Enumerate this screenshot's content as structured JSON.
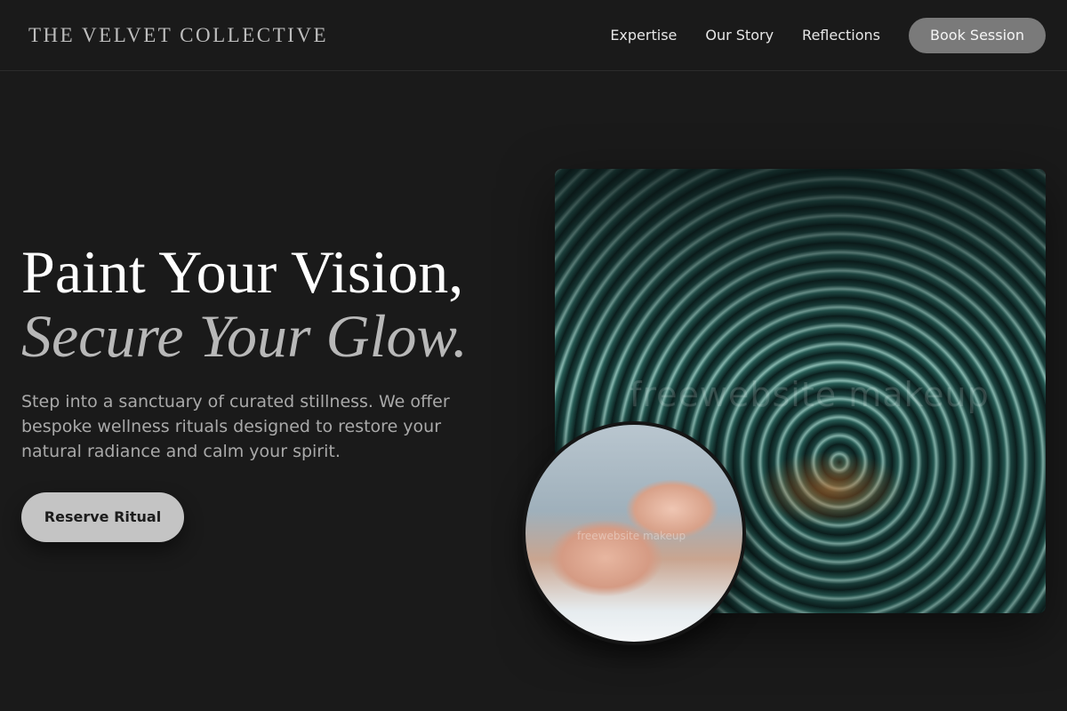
{
  "brand": {
    "name": "THE VELVET COLLECTIVE"
  },
  "nav": {
    "links": [
      "Expertise",
      "Our Story",
      "Reflections"
    ],
    "cta": "Book Session"
  },
  "hero": {
    "title_line1": "Paint Your Vision,",
    "title_line2": "Secure Your Glow.",
    "description": "Step into a sanctuary of curated stillness. We offer bespoke wellness rituals designed to restore your natural radiance and calm your spirit.",
    "cta": "Reserve Ritual"
  },
  "images": {
    "water_watermark": "freewebsite makeup",
    "massage_watermark": "freewebsite makeup"
  },
  "colors": {
    "background": "#1a1a1a",
    "button_primary": "#c4c4c4",
    "button_nav": "#7a7a7a"
  }
}
